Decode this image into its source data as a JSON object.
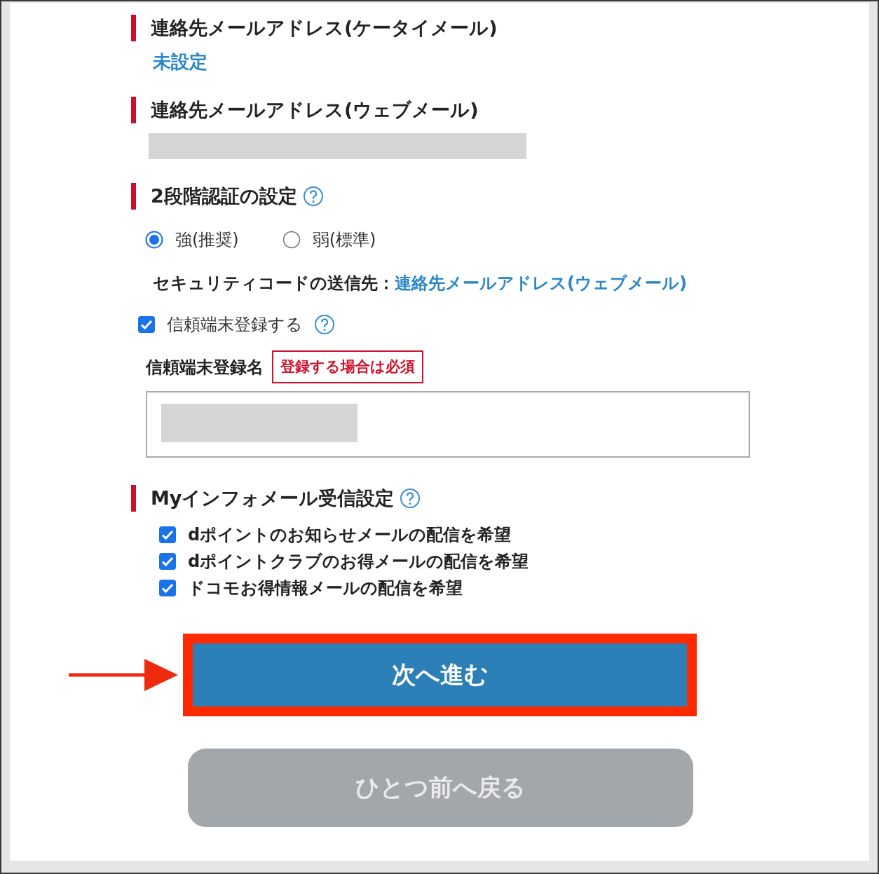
{
  "contact_mobile": {
    "heading": "連絡先メールアドレス(ケータイメール)",
    "value": "未設定"
  },
  "contact_web": {
    "heading": "連絡先メールアドレス(ウェブメール)",
    "redacted": true
  },
  "two_step": {
    "heading": "2段階認証の設定",
    "help": true,
    "options": [
      {
        "label": "強(推奨)",
        "selected": true
      },
      {
        "label": "弱(標準)",
        "selected": false
      }
    ],
    "destination_label": "セキュリティコードの送信先：",
    "destination_value": "連絡先メールアドレス(ウェブメール)",
    "trust": {
      "label": "信頼端末登録する",
      "checked": true,
      "help": true
    },
    "trust_name": {
      "label": "信頼端末登録名",
      "badge": "登録する場合は必須",
      "redacted": true
    }
  },
  "info_mail": {
    "heading": "Myインフォメール受信設定",
    "help": true,
    "options": [
      {
        "label": "dポイントのお知らせメールの配信を希望",
        "checked": true
      },
      {
        "label": "dポイントクラブのお得メールの配信を希望",
        "checked": true
      },
      {
        "label": "ドコモお得情報メールの配信を希望",
        "checked": true
      }
    ]
  },
  "next_button": {
    "label": "次へ進む",
    "highlighted": true
  },
  "back_button": {
    "label": "ひとつ前へ戻る",
    "disabled": true
  }
}
